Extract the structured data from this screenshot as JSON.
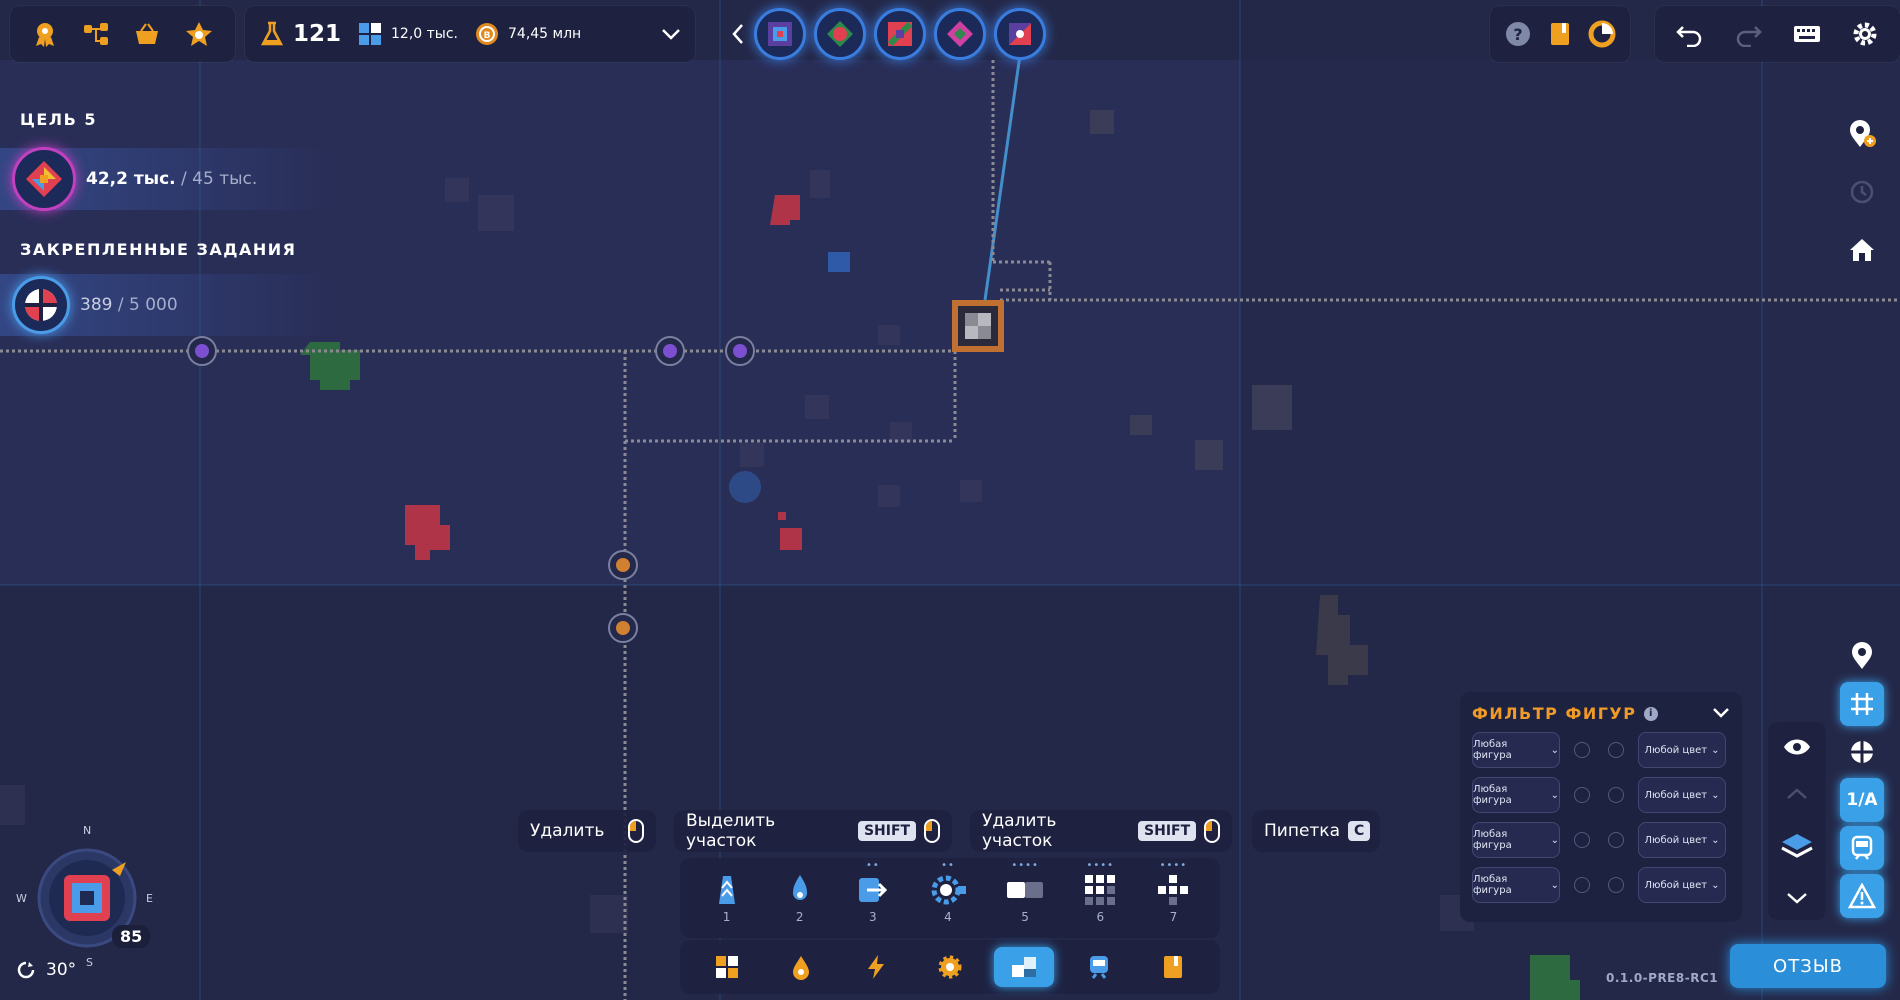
{
  "stats": {
    "research_points": "121",
    "shapes_count": "12,0 тыс.",
    "currency": "74,45 млн"
  },
  "goal": {
    "title": "ЦЕЛЬ 5",
    "current": "42,2 тыс.",
    "total": "/ 45 тыс."
  },
  "pinned": {
    "title": "ЗАКРЕПЛЕННЫЕ ЗАДАНИЯ",
    "current": "389",
    "total": "/ 5 000"
  },
  "hints": [
    {
      "label": "Удалить",
      "key": ""
    },
    {
      "label": "Выделить участок",
      "key": "SHIFT"
    },
    {
      "label": "Удалить участок",
      "key": "SHIFT"
    },
    {
      "label": "Пипетка",
      "key": "C"
    }
  ],
  "tools": [
    {
      "icon": "belt-icon",
      "num": "1"
    },
    {
      "icon": "extractor-icon",
      "num": "2"
    },
    {
      "icon": "tunnel-icon",
      "num": "3"
    },
    {
      "icon": "rotator-icon",
      "num": "4"
    },
    {
      "icon": "cutter-icon",
      "num": "5"
    },
    {
      "icon": "stacker-icon",
      "num": "6"
    },
    {
      "icon": "painter-icon",
      "num": "7"
    }
  ],
  "filter": {
    "title": "ФИЛЬТР ФИГУР",
    "rows": [
      {
        "shape": "Любая фигура",
        "color": "Любой цвет"
      },
      {
        "shape": "Любая фигура",
        "color": "Любой цвет"
      },
      {
        "shape": "Любая фигура",
        "color": "Любой цвет"
      },
      {
        "shape": "Любая фигура",
        "color": "Любой цвет"
      }
    ]
  },
  "compass": {
    "n": "N",
    "s": "S",
    "w": "W",
    "e": "E",
    "zoom": "85",
    "angle": "30°"
  },
  "right_side": {
    "label_1a": "1/A"
  },
  "feedback_label": "ОТЗЫВ",
  "version": "0.1.0-PRE8-RC1",
  "colors": {
    "accent": "#3aa0e8",
    "filter_title": "#f09a28",
    "background": "#242848"
  }
}
